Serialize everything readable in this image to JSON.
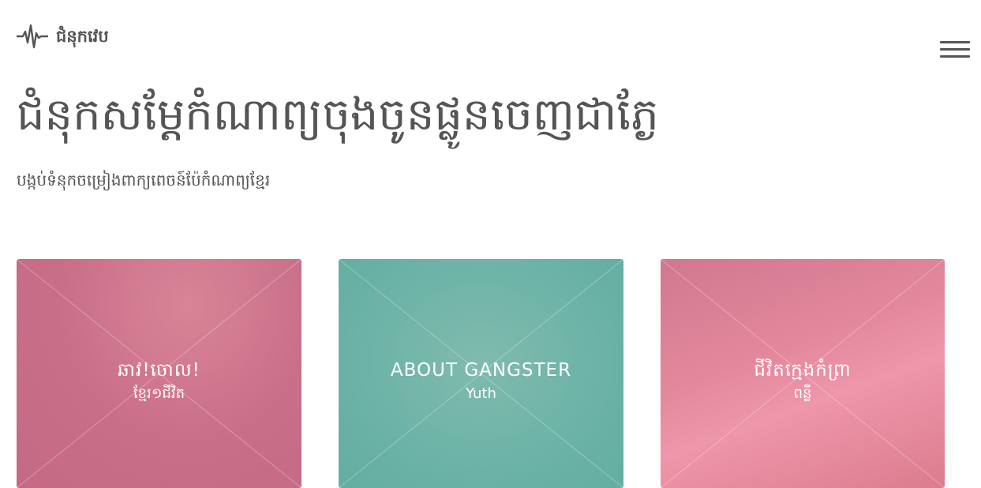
{
  "header": {
    "logo_icon": "heartbeat-icon",
    "site_name": "ជំនុកវេប"
  },
  "menu": {
    "icon": "hamburger-menu-icon"
  },
  "hero": {
    "title": "ជំនុកសម្ដែកំណាព្យចុងចូនផ្លូនចេញជាភ្ងែ",
    "subtitle": "បង្កប់ទំនុកចម្រៀងពាក្យពេចន៍ប៉ែកំណាព្យខ្មែរ"
  },
  "cards": [
    {
      "title": "ឆាវ!ចោល!",
      "subtitle": "ខ្មែរ១ជីវិត",
      "color": "#c86e88"
    },
    {
      "title": "ABOUT GANGSTER",
      "subtitle": "Yuth",
      "color": "#6fb4a8"
    },
    {
      "title": "ជីវិតក្មេងកំព្រា",
      "subtitle": "ពន្លឺ",
      "color": "#e3889c"
    }
  ]
}
